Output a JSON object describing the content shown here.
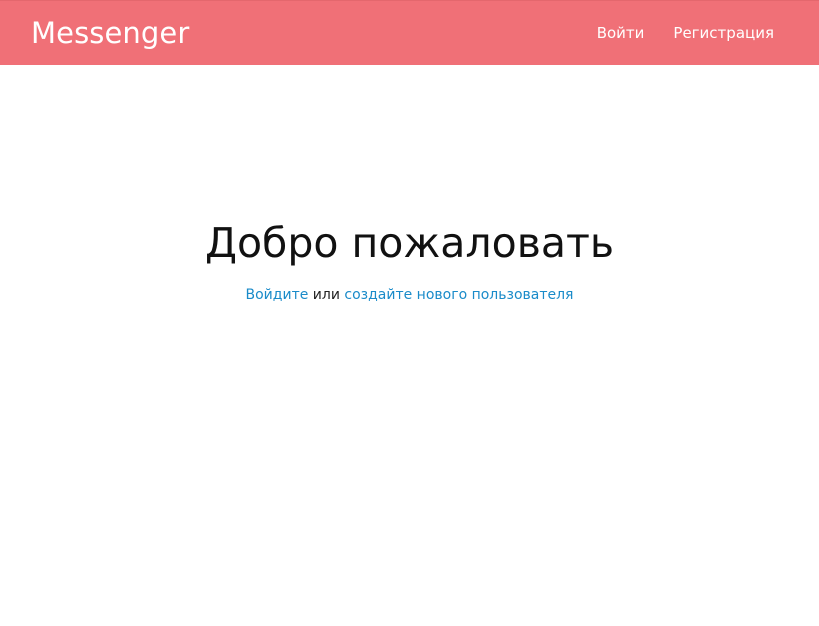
{
  "colors": {
    "navbar_bg": "#f07077",
    "navbar_text": "#ffffff",
    "link": "#1a8bc9",
    "title": "#111111"
  },
  "navbar": {
    "brand": "Messenger",
    "links": [
      {
        "label": "Войти"
      },
      {
        "label": "Регистрация"
      }
    ]
  },
  "hero": {
    "title": "Добро пожаловать",
    "login_link": "Войдите",
    "connector": " или ",
    "register_link": "создайте нового пользователя"
  }
}
